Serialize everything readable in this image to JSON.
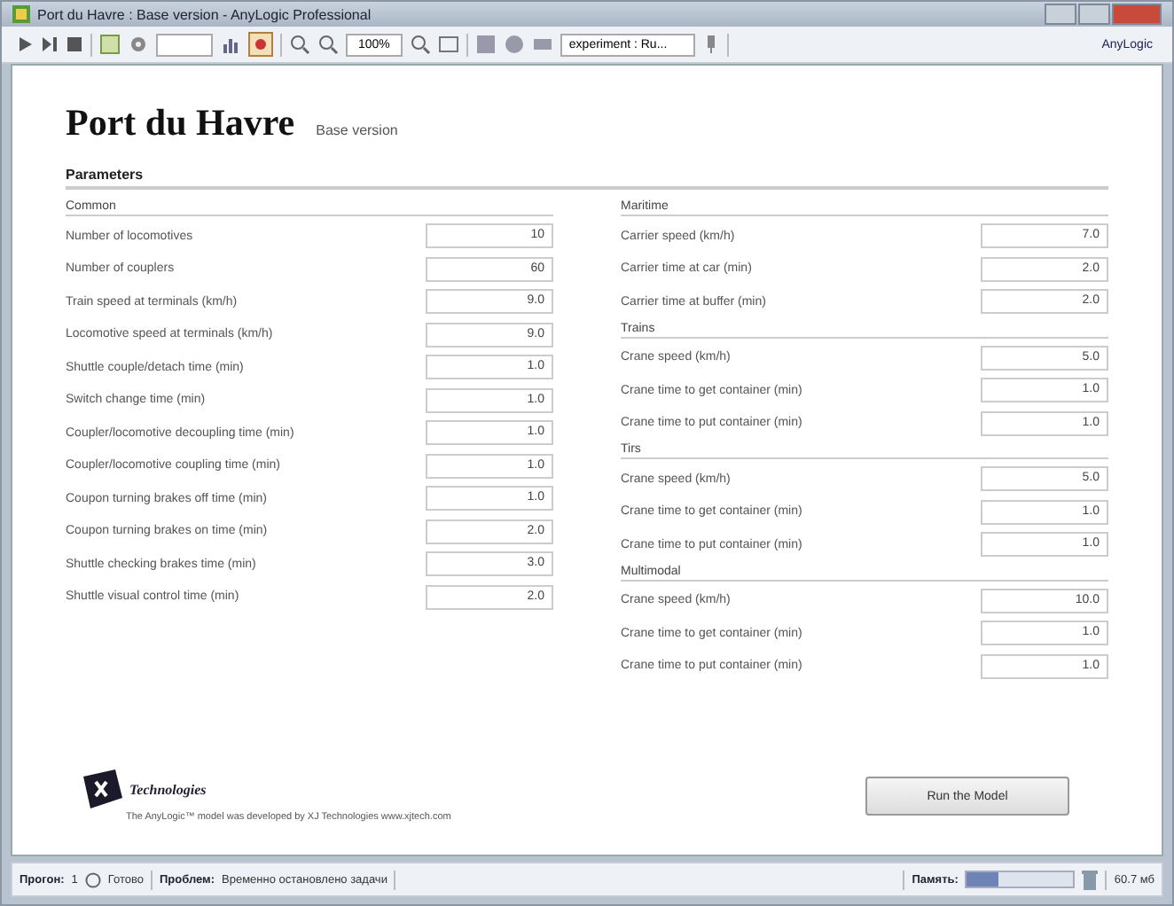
{
  "window": {
    "title": "Port du Havre : Base version - AnyLogic Professional"
  },
  "toolbar": {
    "zoom": "100%",
    "dropdown": "experiment : Ru...",
    "brand_button": "AnyLogic"
  },
  "page": {
    "title": "Port du Havre",
    "subtitle": "Base version",
    "section": "Parameters",
    "left_groups": [
      {
        "heading": "Common",
        "rows": [
          {
            "label": "Number of locomotives",
            "value": "10"
          },
          {
            "label": "Number of couplers",
            "value": "60"
          },
          {
            "label": "Train speed at terminals (km/h)",
            "value": "9.0"
          },
          {
            "label": "Locomotive speed at terminals (km/h)",
            "value": "9.0"
          },
          {
            "label": "Shuttle couple/detach time (min)",
            "value": "1.0"
          },
          {
            "label": "Switch change time (min)",
            "value": "1.0"
          },
          {
            "label": "Coupler/locomotive decoupling time (min)",
            "value": "1.0"
          },
          {
            "label": "Coupler/locomotive coupling time (min)",
            "value": "1.0"
          },
          {
            "label": "Coupon turning brakes off time (min)",
            "value": "1.0"
          },
          {
            "label": "Coupon turning brakes on time (min)",
            "value": "2.0"
          },
          {
            "label": "Shuttle checking brakes time (min)",
            "value": "3.0"
          },
          {
            "label": "Shuttle visual control time (min)",
            "value": "2.0"
          }
        ]
      }
    ],
    "right_groups": [
      {
        "heading": "Maritime",
        "rows": [
          {
            "label": "Carrier speed (km/h)",
            "value": "7.0"
          },
          {
            "label": "Carrier time at car (min)",
            "value": "2.0"
          },
          {
            "label": "Carrier time at buffer (min)",
            "value": "2.0"
          }
        ]
      },
      {
        "heading": "Trains",
        "rows": [
          {
            "label": "Crane speed (km/h)",
            "value": "5.0"
          },
          {
            "label": "Crane time to get container (min)",
            "value": "1.0"
          },
          {
            "label": "Crane time to put container (min)",
            "value": "1.0"
          }
        ]
      },
      {
        "heading": "Tirs",
        "rows": [
          {
            "label": "Crane speed (km/h)",
            "value": "5.0"
          },
          {
            "label": "Crane time to get container (min)",
            "value": "1.0"
          },
          {
            "label": "Crane time to put container (min)",
            "value": "1.0"
          }
        ]
      },
      {
        "heading": "Multimodal",
        "rows": [
          {
            "label": "Crane speed (km/h)",
            "value": "10.0"
          },
          {
            "label": "Crane time to get container (min)",
            "value": "1.0"
          },
          {
            "label": "Crane time to put container (min)",
            "value": "1.0"
          }
        ]
      }
    ],
    "footer": {
      "company": "Technologies",
      "note": "The AnyLogic™ model was developed by XJ Technologies www.xjtech.com"
    },
    "run_button": "Run the Model"
  },
  "status_bar": {
    "run_label": "Прогон:",
    "run_value": "1",
    "state": "Готово",
    "problem_label": "Проблем:",
    "problem_text": "Временно остановлено задачи",
    "memory_label": "Память:",
    "memory_meter": {
      "level": 0.3
    },
    "memory_value": "60.7 мб"
  }
}
